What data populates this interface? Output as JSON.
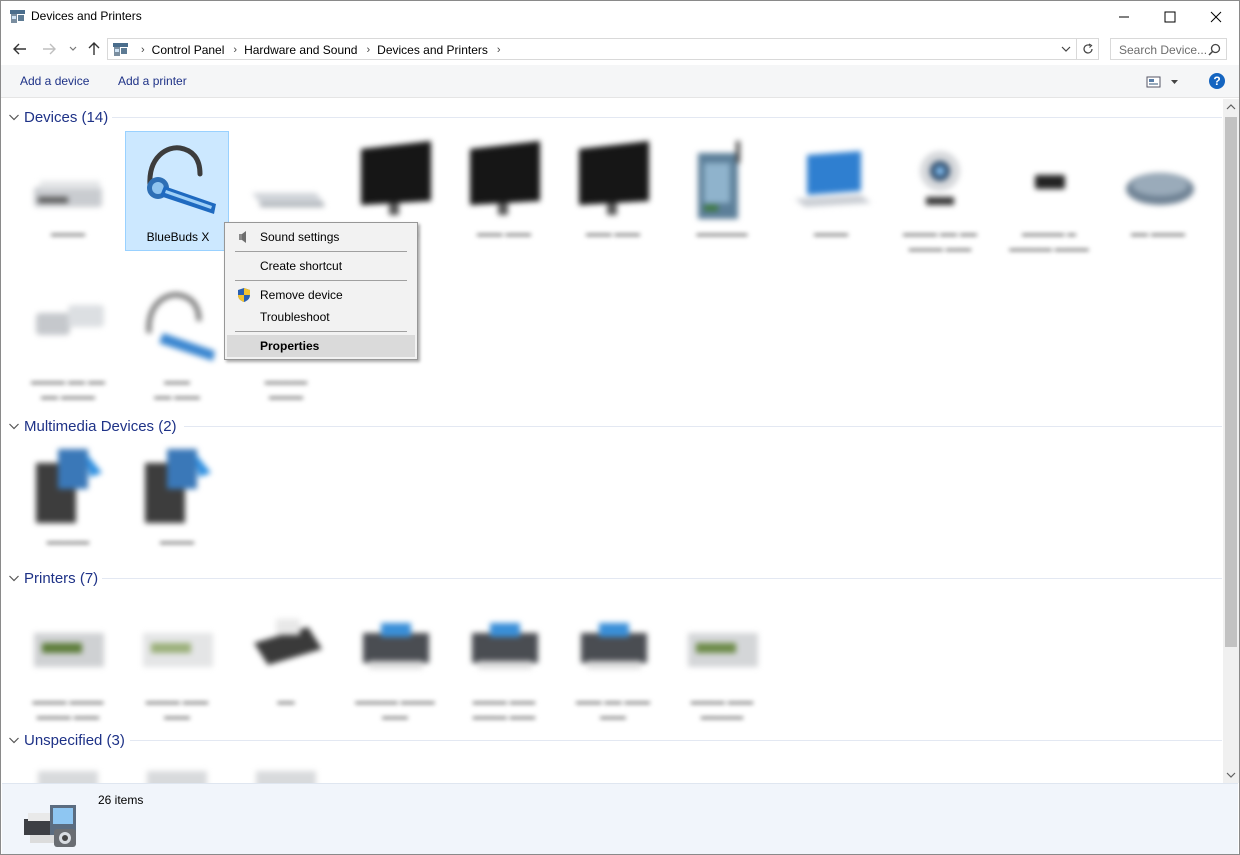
{
  "window": {
    "title": "Devices and Printers",
    "icon": "devices-printers-icon"
  },
  "address": {
    "crumbs": [
      "Control Panel",
      "Hardware and Sound",
      "Devices and Printers"
    ],
    "search_placeholder": "Search Device..."
  },
  "commands": {
    "add_device": "Add a device",
    "add_printer": "Add a printer",
    "help": "?"
  },
  "groups": {
    "devices": {
      "title": "Devices (14)",
      "items": [
        "",
        "BlueBuds X",
        "",
        "",
        "",
        "",
        "",
        "",
        "",
        "",
        "",
        "",
        "",
        ""
      ]
    },
    "multimedia": {
      "title": "Multimedia Devices (2)"
    },
    "printers": {
      "title": "Printers (7)"
    },
    "unspecified": {
      "title": "Unspecified (3)"
    }
  },
  "context_menu": {
    "items": [
      {
        "label": "Sound settings",
        "icon": "speaker-icon"
      },
      {
        "label": "Create shortcut"
      },
      {
        "label": "Remove device",
        "icon": "uac-shield-icon"
      },
      {
        "label": "Troubleshoot"
      },
      {
        "label": "Properties",
        "bold": true,
        "highlighted": true
      }
    ]
  },
  "status": {
    "item_count": "26 items"
  },
  "colors": {
    "link_blue": "#1e3287",
    "selection_bg": "#cce8ff",
    "selection_border": "#99d1ff",
    "status_bg": "#f1f5fb"
  }
}
